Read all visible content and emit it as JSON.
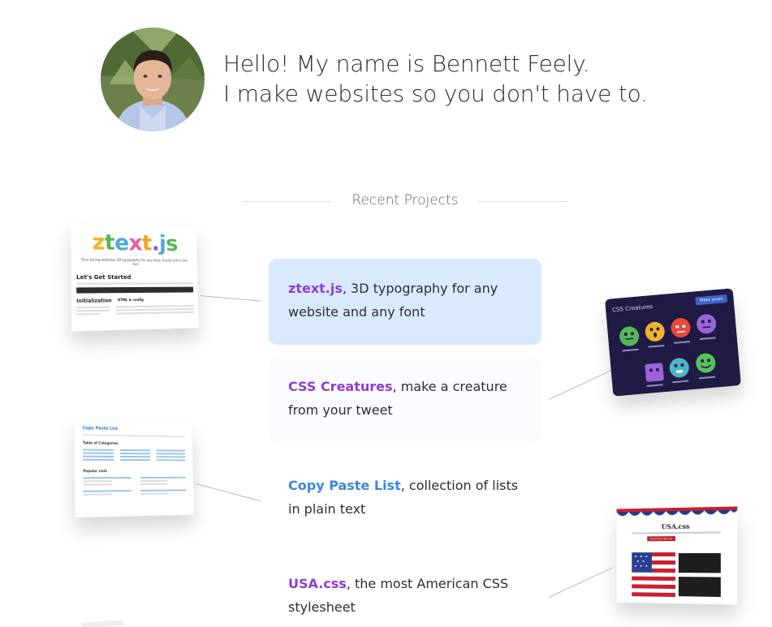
{
  "header": {
    "intro_line1": "Hello! My name is Bennett Feely.",
    "intro_line2": "I make websites so you don't have to."
  },
  "section": {
    "title": "Recent Projects"
  },
  "colors": {
    "link_purple": "#8d3dd8",
    "link_blue": "#3b86e0",
    "active_card_bg": "#d9eaff"
  },
  "projects": [
    {
      "name": "ztext.js",
      "desc": ", 3D typography for any website and any font",
      "color": "#8d3dd8",
      "active": true
    },
    {
      "name": "CSS Creatures",
      "desc": ", make a creature from your tweet",
      "color": "#8d3dd8",
      "active": false
    },
    {
      "name": "Copy Paste List",
      "desc": ", collection of lists in plain text",
      "color": "#3b86e0",
      "active": false
    },
    {
      "name": "USA.css",
      "desc": ", the most American CSS stylesheet",
      "color": "#8d3dd8",
      "active": false
    }
  ],
  "thumbs": {
    "ztext": {
      "logo": "ztext.js",
      "tagline": "Give boring websites 3D typography for any body. Easily and in any font.",
      "heading": "Let's Get Started",
      "subheading": "Initialization",
      "subheading2": "HTML & config"
    },
    "creatures": {
      "title": "CSS Creatures",
      "button": "Make yours"
    },
    "copypaste": {
      "title": "Copy Paste List",
      "subtitle": "Table of Categories",
      "section": "Popular Lists"
    },
    "usa": {
      "title": "USA.css",
      "button": "Download USA.css"
    }
  }
}
